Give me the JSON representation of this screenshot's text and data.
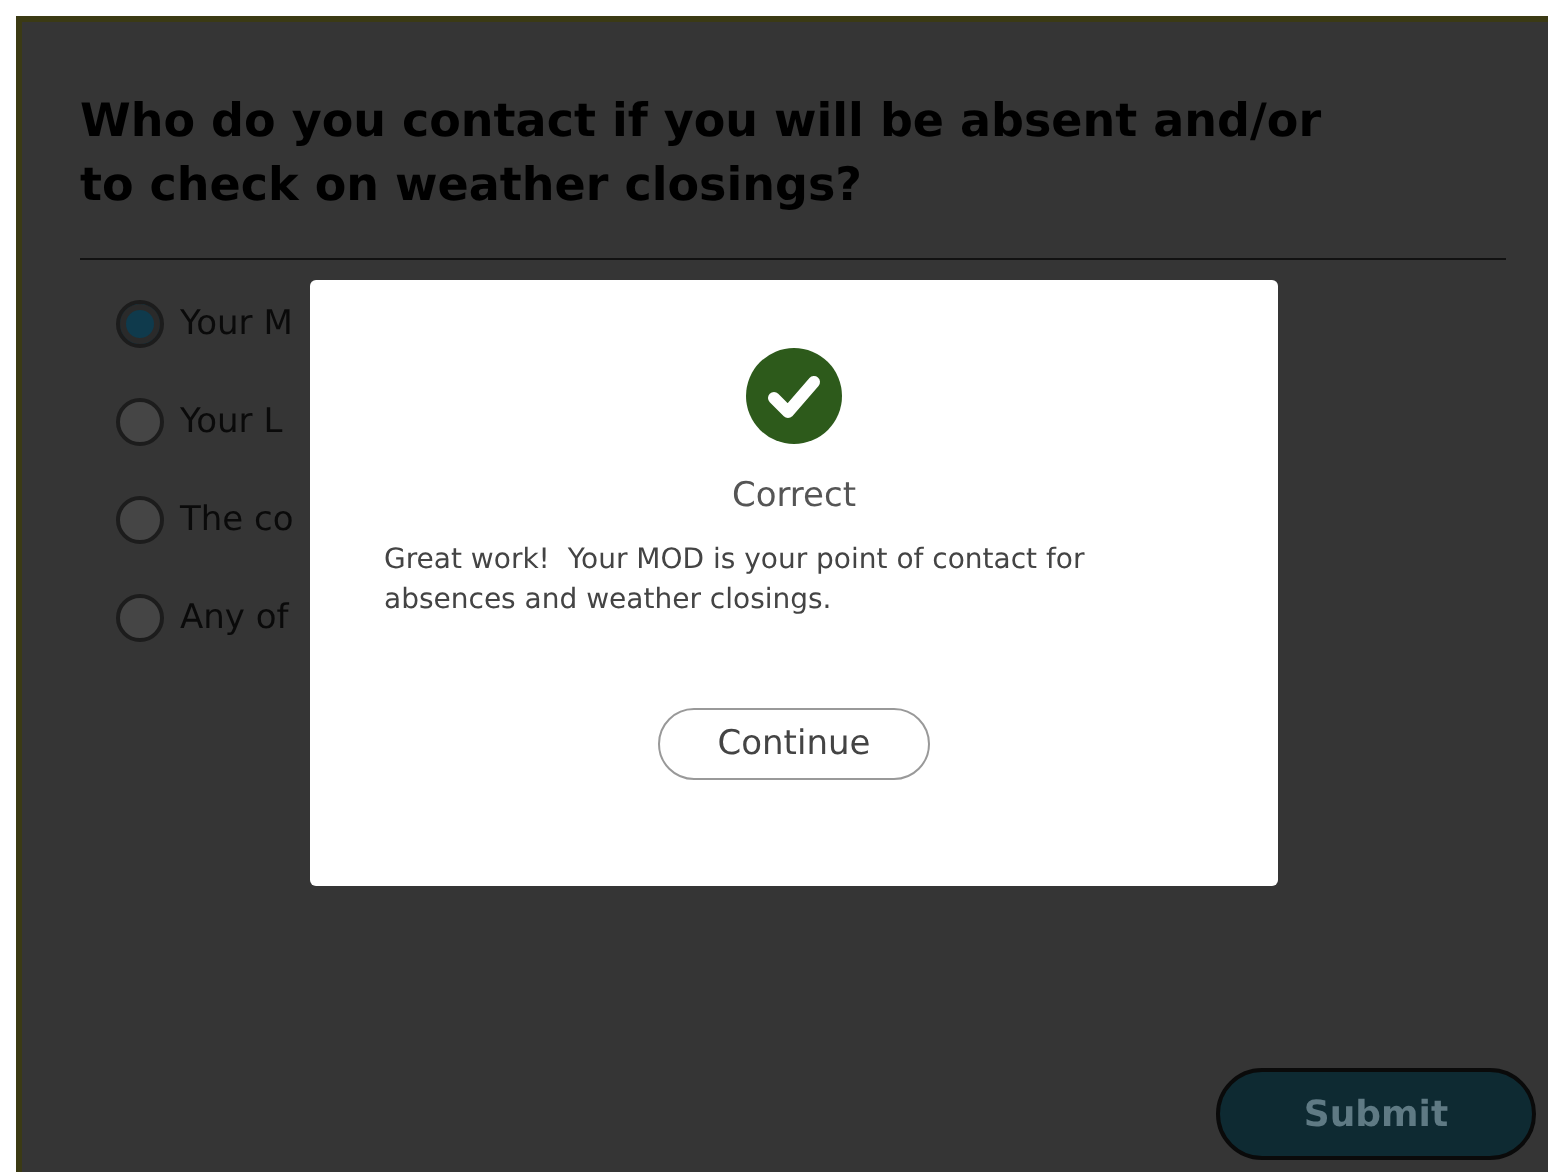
{
  "question": {
    "title": "Who do you contact if you will be absent and/or to check on weather closings?",
    "options": [
      {
        "label": "Your M",
        "selected": true
      },
      {
        "label": "Your L",
        "selected": false
      },
      {
        "label": "The co",
        "selected": false
      },
      {
        "label": "Any of",
        "selected": false
      }
    ]
  },
  "submit": {
    "label": "Submit",
    "disabled": true
  },
  "feedback": {
    "correct": true,
    "title": "Correct",
    "message": "Great work!  Your MOD is your point of contact for absences and weather closings.",
    "button": "Continue"
  }
}
